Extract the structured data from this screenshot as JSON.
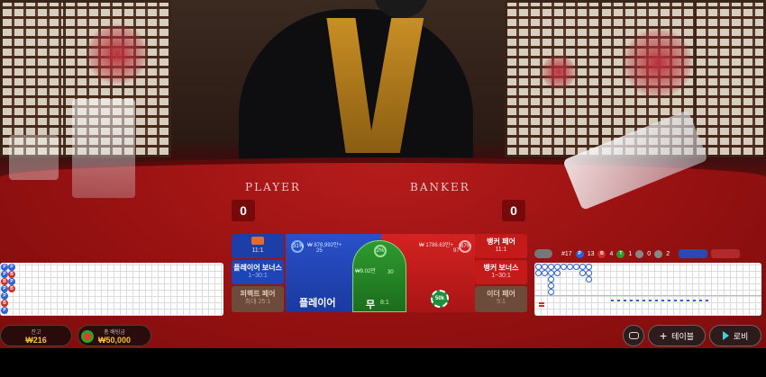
{
  "table": {
    "player_label": "PLAYER",
    "banker_label": "BANKER",
    "player_score": "0",
    "banker_score": "0"
  },
  "bets": {
    "player_pair": {
      "label": "플레이어 페어",
      "odds": "11:1"
    },
    "player_bonus": {
      "label": "플레이어 보너스",
      "odds": "1~30:1"
    },
    "perfect_pair": {
      "label": "퍼펙트 페어",
      "odds": "최대 25:1"
    },
    "player": {
      "label": "플레이어",
      "odds": "1:1",
      "amount": "₩ 878,992만+",
      "count": "25",
      "percent": "31%"
    },
    "tie": {
      "label": "무",
      "odds": "8:1",
      "amount": "₩9.02만",
      "count": "30",
      "percent": "2%",
      "chip": "50k"
    },
    "banker": {
      "label": "뱅커",
      "amount": "₩ 1786.63만+",
      "count": "97",
      "percent": "67%"
    },
    "banker_pair": {
      "label": "뱅커 페어",
      "odds": "11:1"
    },
    "banker_bonus": {
      "label": "뱅커 보너스",
      "odds": "1~30:1"
    },
    "either_pair": {
      "label": "이더 페어",
      "odds": "5:1"
    }
  },
  "stats": {
    "round": "#17",
    "player_count": "13",
    "banker_count": "4",
    "tie_count": "1",
    "player_pair_count": "0",
    "banker_pair_count": "2",
    "letters": {
      "p": "P",
      "b": "B",
      "t": "T"
    }
  },
  "bead_road": [
    "P",
    "P",
    "B",
    "P",
    "P",
    "B",
    "P",
    "P",
    "B",
    "P",
    "P",
    "B"
  ],
  "balance": {
    "label": "잔고",
    "value": "₩216"
  },
  "total_bet": {
    "label": "총 배팅금",
    "value": "₩50,000"
  },
  "controls": {
    "table_button": "테이블",
    "lobby_button": "로비"
  },
  "colors": {
    "player": "#1b3fa6",
    "banker": "#c41a1a",
    "tie": "#2e9a2e"
  }
}
